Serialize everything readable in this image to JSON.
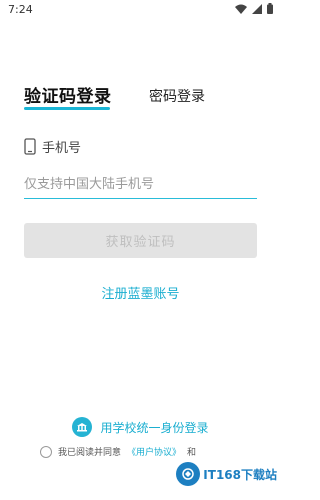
{
  "status_bar": {
    "time": "7:24"
  },
  "tabs": {
    "sms_login": "验证码登录",
    "password_login": "密码登录"
  },
  "form": {
    "phone_label": "手机号",
    "phone_placeholder": "仅支持中国大陆手机号",
    "get_code_button": "获取验证码"
  },
  "register_link": "注册蓝墨账号",
  "campus_login": "用学校统一身份登录",
  "agreement": {
    "prefix": "我已阅读并同意",
    "user_agreement": "《用户协议》",
    "and": "和"
  },
  "watermark": {
    "text": "IT168下载站"
  },
  "colors": {
    "accent": "#1bb6d6",
    "link": "#1aaed0",
    "button_disabled_bg": "#e3e3e3",
    "button_disabled_text": "#bfbfbf"
  }
}
